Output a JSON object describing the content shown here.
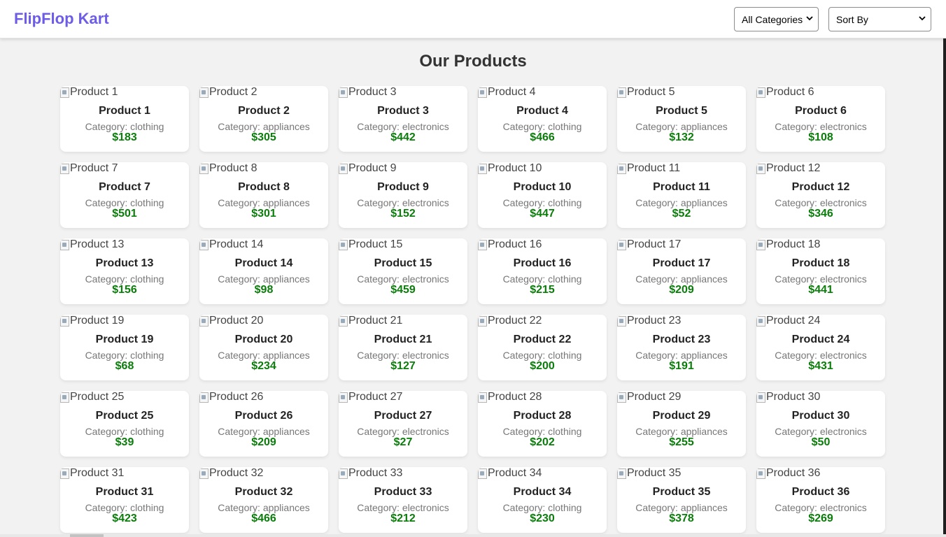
{
  "header": {
    "brand": "FlipFlop Kart",
    "category_select": {
      "value": "All Categories"
    },
    "sort_select": {
      "value": "Sort By"
    }
  },
  "main": {
    "title": "Our Products",
    "category_prefix": "Category: ",
    "currency": "$",
    "products": [
      {
        "name": "Product 1",
        "alt": "Product 1",
        "category": "clothing",
        "price": 183
      },
      {
        "name": "Product 2",
        "alt": "Product 2",
        "category": "appliances",
        "price": 305
      },
      {
        "name": "Product 3",
        "alt": "Product 3",
        "category": "electronics",
        "price": 442
      },
      {
        "name": "Product 4",
        "alt": "Product 4",
        "category": "clothing",
        "price": 466
      },
      {
        "name": "Product 5",
        "alt": "Product 5",
        "category": "appliances",
        "price": 132
      },
      {
        "name": "Product 6",
        "alt": "Product 6",
        "category": "electronics",
        "price": 108
      },
      {
        "name": "Product 7",
        "alt": "Product 7",
        "category": "clothing",
        "price": 501
      },
      {
        "name": "Product 8",
        "alt": "Product 8",
        "category": "appliances",
        "price": 301
      },
      {
        "name": "Product 9",
        "alt": "Product 9",
        "category": "electronics",
        "price": 152
      },
      {
        "name": "Product 10",
        "alt": "Product 10",
        "category": "clothing",
        "price": 447
      },
      {
        "name": "Product 11",
        "alt": "Product 11",
        "category": "appliances",
        "price": 52
      },
      {
        "name": "Product 12",
        "alt": "Product 12",
        "category": "electronics",
        "price": 346
      },
      {
        "name": "Product 13",
        "alt": "Product 13",
        "category": "clothing",
        "price": 156
      },
      {
        "name": "Product 14",
        "alt": "Product 14",
        "category": "appliances",
        "price": 98
      },
      {
        "name": "Product 15",
        "alt": "Product 15",
        "category": "electronics",
        "price": 459
      },
      {
        "name": "Product 16",
        "alt": "Product 16",
        "category": "clothing",
        "price": 215
      },
      {
        "name": "Product 17",
        "alt": "Product 17",
        "category": "appliances",
        "price": 209
      },
      {
        "name": "Product 18",
        "alt": "Product 18",
        "category": "electronics",
        "price": 441
      },
      {
        "name": "Product 19",
        "alt": "Product 19",
        "category": "clothing",
        "price": 68
      },
      {
        "name": "Product 20",
        "alt": "Product 20",
        "category": "appliances",
        "price": 234
      },
      {
        "name": "Product 21",
        "alt": "Product 21",
        "category": "electronics",
        "price": 127
      },
      {
        "name": "Product 22",
        "alt": "Product 22",
        "category": "clothing",
        "price": 200
      },
      {
        "name": "Product 23",
        "alt": "Product 23",
        "category": "appliances",
        "price": 191
      },
      {
        "name": "Product 24",
        "alt": "Product 24",
        "category": "electronics",
        "price": 431
      },
      {
        "name": "Product 25",
        "alt": "Product 25",
        "category": "clothing",
        "price": 39
      },
      {
        "name": "Product 26",
        "alt": "Product 26",
        "category": "appliances",
        "price": 209
      },
      {
        "name": "Product 27",
        "alt": "Product 27",
        "category": "electronics",
        "price": 27
      },
      {
        "name": "Product 28",
        "alt": "Product 28",
        "category": "clothing",
        "price": 202
      },
      {
        "name": "Product 29",
        "alt": "Product 29",
        "category": "appliances",
        "price": 255
      },
      {
        "name": "Product 30",
        "alt": "Product 30",
        "category": "electronics",
        "price": 50
      },
      {
        "name": "Product 31",
        "alt": "Product 31",
        "category": "clothing",
        "price": 423
      },
      {
        "name": "Product 32",
        "alt": "Product 32",
        "category": "appliances",
        "price": 466
      },
      {
        "name": "Product 33",
        "alt": "Product 33",
        "category": "electronics",
        "price": 212
      },
      {
        "name": "Product 34",
        "alt": "Product 34",
        "category": "clothing",
        "price": 230
      },
      {
        "name": "Product 35",
        "alt": "Product 35",
        "category": "appliances",
        "price": 378
      },
      {
        "name": "Product 36",
        "alt": "Product 36",
        "category": "electronics",
        "price": 269
      }
    ]
  },
  "colors": {
    "brand": "#6c5ce7",
    "price": "#0a7d0a",
    "background": "#f2f2f2",
    "card": "#ffffff"
  },
  "icons": {
    "select_chevron": "chevron-down-icon",
    "product_image": "broken-image-icon"
  }
}
